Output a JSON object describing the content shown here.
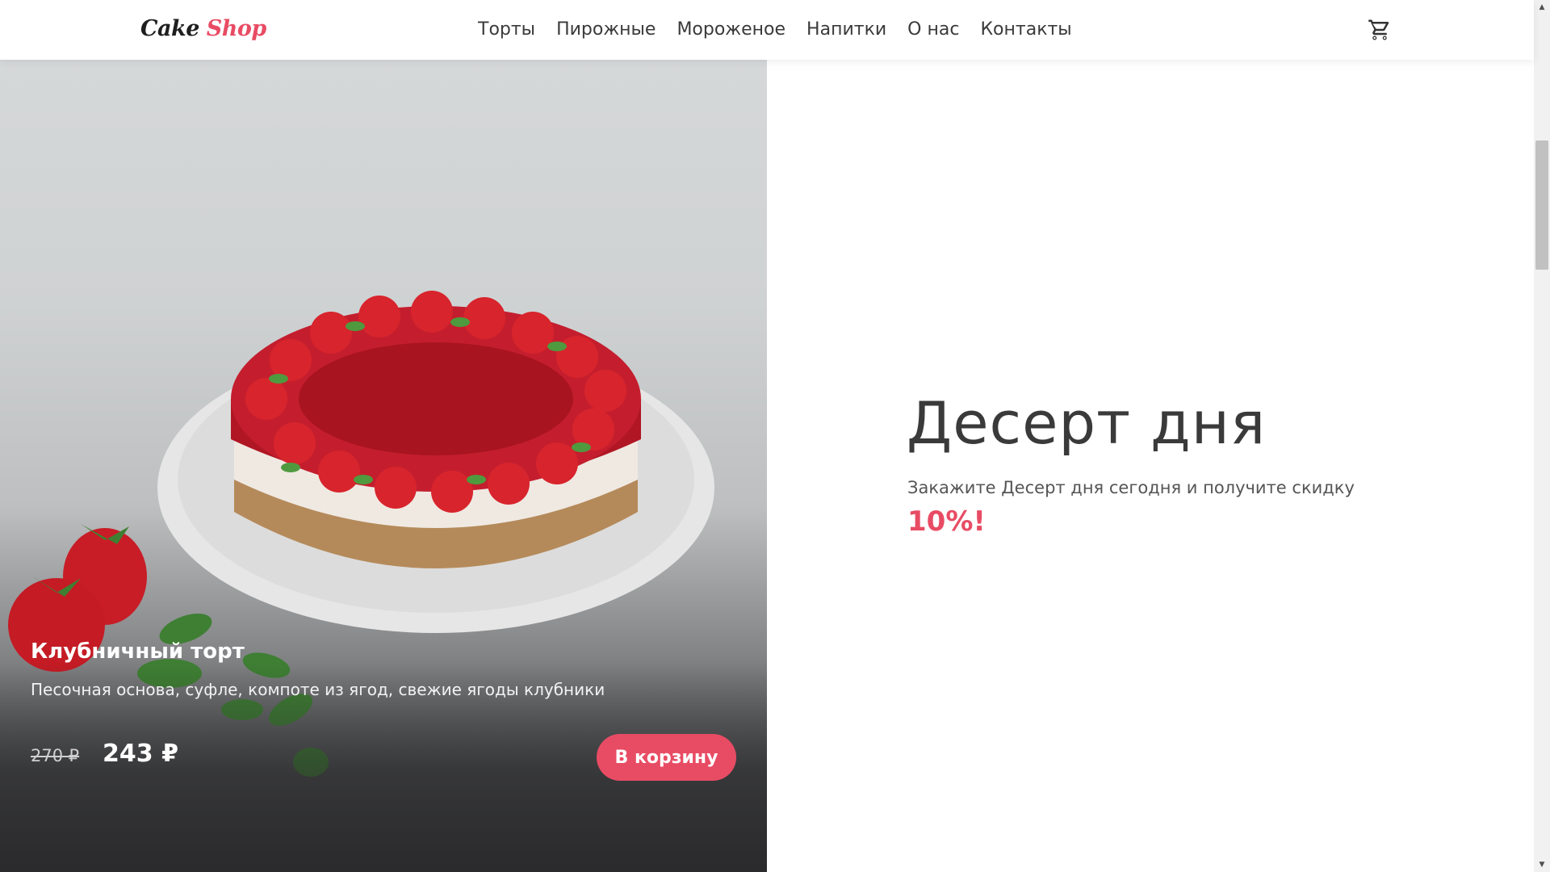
{
  "header": {
    "logo_part1": "Cake",
    "logo_part2": "Shop",
    "nav": [
      "Торты",
      "Пирожные",
      "Мороженое",
      "Напитки",
      "О нас",
      "Контакты"
    ],
    "cart_icon": "shopping-cart-icon"
  },
  "product": {
    "title": "Клубничный торт",
    "description": "Песочная основа, суфле, компоте из ягод, свежие ягоды клубники",
    "old_price": "270 ₽",
    "new_price": "243 ₽",
    "button_label": "В корзину"
  },
  "promo": {
    "title": "Десерт дня",
    "subtitle": "Закажите Десерт дня сегодня и получите скидку",
    "discount": "10%!"
  },
  "colors": {
    "accent": "#e84c64",
    "text_dark": "#3a3a3a"
  }
}
